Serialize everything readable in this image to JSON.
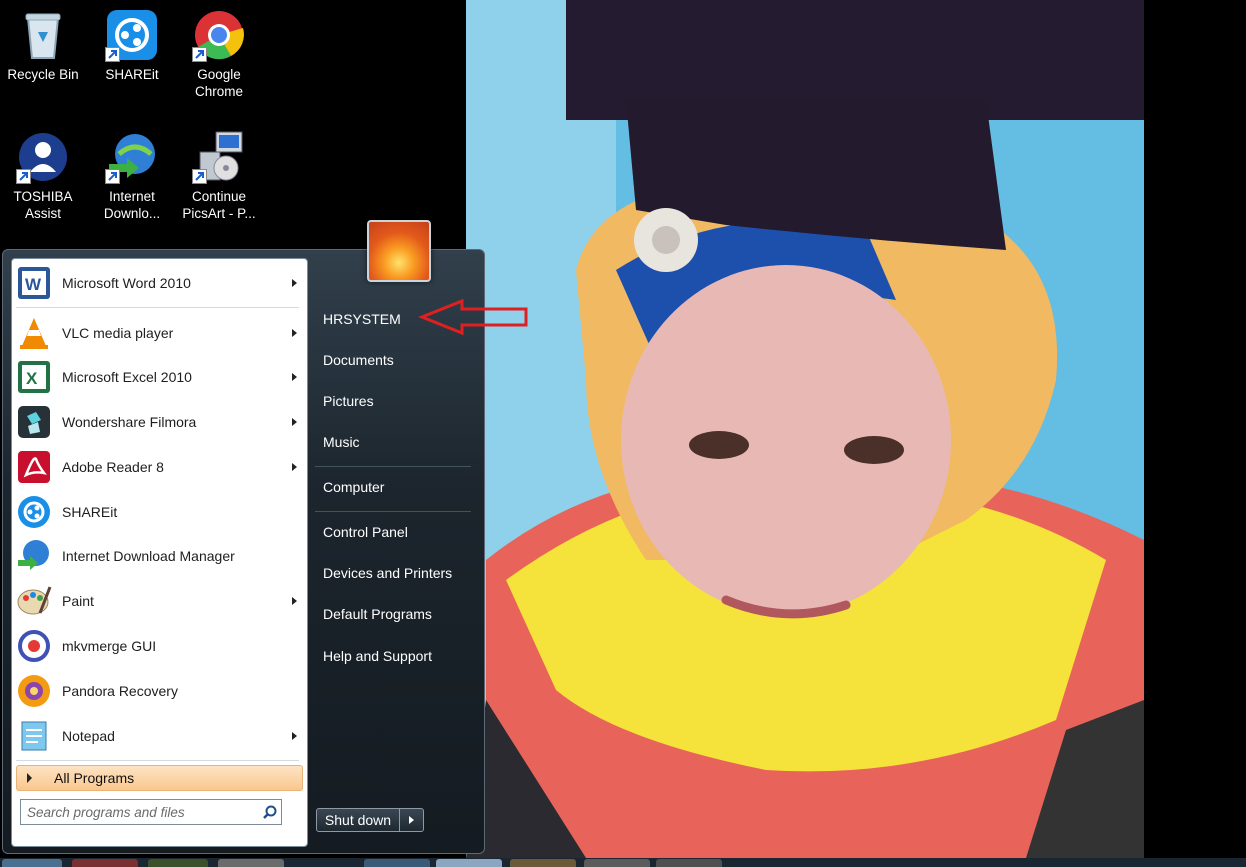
{
  "desktop": {
    "icons": [
      {
        "label": "Recycle Bin"
      },
      {
        "label": "SHAREit"
      },
      {
        "label": "Google Chrome"
      },
      {
        "label": "TOSHIBA Assist"
      },
      {
        "label": "Internet Downlo..."
      },
      {
        "label": "Continue PicsArt - P..."
      }
    ]
  },
  "start_menu": {
    "programs": [
      {
        "label": "Microsoft Word 2010",
        "has_submenu": true
      },
      {
        "label": "VLC media player",
        "has_submenu": true
      },
      {
        "label": "Microsoft Excel 2010",
        "has_submenu": true
      },
      {
        "label": "Wondershare Filmora",
        "has_submenu": true
      },
      {
        "label": "Adobe Reader 8",
        "has_submenu": true
      },
      {
        "label": "SHAREit",
        "has_submenu": false
      },
      {
        "label": "Internet Download Manager",
        "has_submenu": false
      },
      {
        "label": "Paint",
        "has_submenu": true
      },
      {
        "label": "mkvmerge GUI",
        "has_submenu": false
      },
      {
        "label": "Pandora Recovery",
        "has_submenu": false
      },
      {
        "label": "Notepad",
        "has_submenu": true
      }
    ],
    "all_programs_label": "All Programs",
    "search_placeholder": "Search programs and files",
    "right_items": [
      {
        "label": "HRSYSTEM"
      },
      {
        "label": "Documents"
      },
      {
        "label": "Pictures"
      },
      {
        "label": "Music"
      },
      {
        "label": "Computer"
      },
      {
        "label": "Control Panel"
      },
      {
        "label": "Devices and Printers"
      },
      {
        "label": "Default Programs"
      },
      {
        "label": "Help and Support"
      }
    ],
    "shutdown_label": "Shut down"
  },
  "colors": {
    "annotation_arrow": "#e02020",
    "all_programs_highlight": "#f9c78e"
  }
}
